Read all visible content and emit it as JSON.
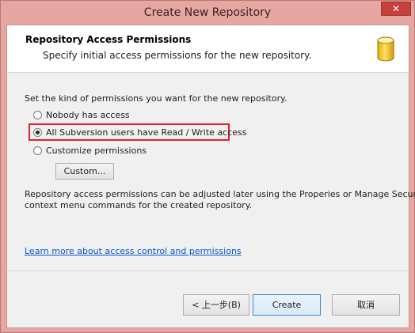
{
  "window": {
    "title": "Create New Repository",
    "close_glyph": "✕"
  },
  "header": {
    "title": "Repository Access Permissions",
    "subtitle": "Specify initial access permissions for the new repository.",
    "icon": "database-icon"
  },
  "body": {
    "instruction": "Set the kind of permissions you want for the new repository.",
    "options": [
      {
        "label": "Nobody has access",
        "selected": false
      },
      {
        "label": "All Subversion users have Read / Write access",
        "selected": true
      },
      {
        "label": "Customize permissions",
        "selected": false
      }
    ],
    "custom_button": "Custom...",
    "note_line1": "Repository access permissions can be adjusted later using the Properies or Manage Security",
    "note_line2": "context menu commands for the created repository.",
    "learn_link": "Learn more about access control and permissions"
  },
  "footer": {
    "back_button": "< 上一步(B)",
    "create_button": "Create",
    "cancel_button": "取消"
  },
  "colors": {
    "highlight": "#e3202b",
    "link": "#0a58c9",
    "titlebar": "#e6a7a2"
  }
}
